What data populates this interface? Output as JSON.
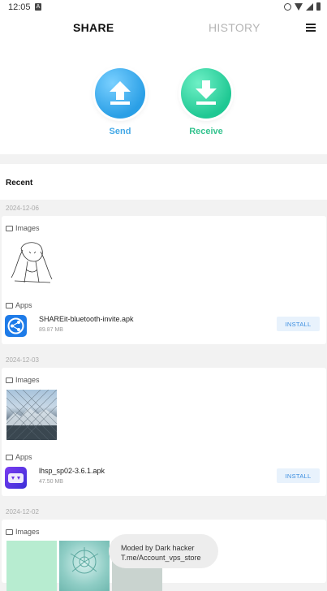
{
  "status": {
    "time": "12:05"
  },
  "tabs": {
    "share": "SHARE",
    "history": "HISTORY"
  },
  "actions": {
    "send": "Send",
    "receive": "Receive"
  },
  "recent": {
    "title": "Recent",
    "groups": [
      {
        "date": "2024-12-06",
        "images_label": "Images",
        "apps_label": "Apps",
        "app": {
          "name": "SHAREit-bluetooth-invite.apk",
          "size": "89.87 MB",
          "install_label": "INSTALL"
        }
      },
      {
        "date": "2024-12-03",
        "images_label": "Images",
        "apps_label": "Apps",
        "app": {
          "name": "lhsp_sp02-3.6.1.apk",
          "size": "47.50 MB",
          "install_label": "INSTALL"
        }
      },
      {
        "date": "2024-12-02",
        "images_label": "Images"
      }
    ]
  },
  "toast": {
    "line1": "Moded by Dark hacker",
    "line2": "T.me/Account_vps_store"
  },
  "colors": {
    "send": "#2a9fe6",
    "receive": "#1fc893",
    "install_text": "#3a8de0"
  }
}
